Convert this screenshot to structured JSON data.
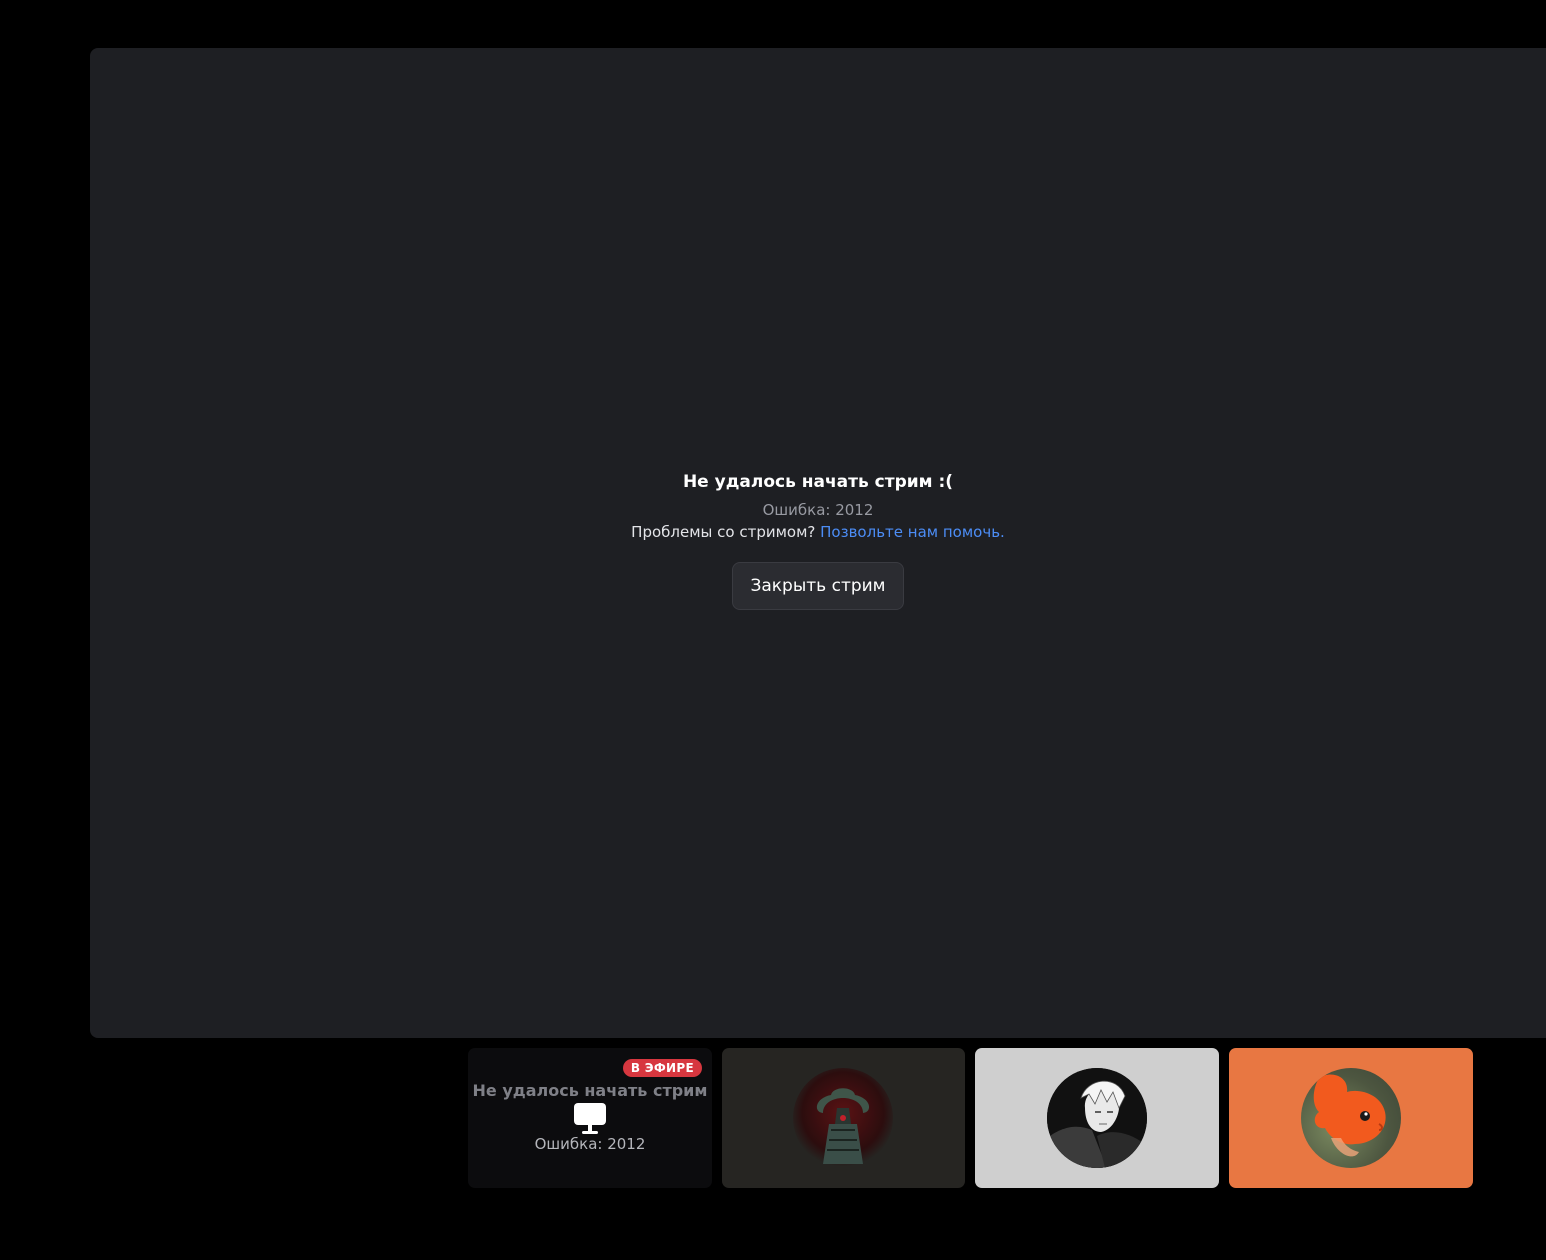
{
  "stream": {
    "error_title": "Не удалось начать стрим :(",
    "error_code": "Ошибка: 2012",
    "help_question": "Проблемы со стримом?",
    "help_link": "Позвольте нам помочь.",
    "close_button": "Закрыть стрим"
  },
  "tiles": {
    "stream_tile": {
      "live_badge": "В ЭФИРЕ",
      "title": "Не удалось начать стрим",
      "icon": "monitor-icon",
      "error_code": "Ошибка: 2012"
    },
    "participants": [
      {
        "avatar": "tree-figure-avatar",
        "background": "#262522"
      },
      {
        "avatar": "manga-character-avatar",
        "background": "#cfcfcf"
      },
      {
        "avatar": "orange-fish-avatar",
        "background": "#e87742"
      }
    ]
  },
  "colors": {
    "page_background": "#000000",
    "stage_background": "#1e1f23",
    "link": "#4c8df6",
    "live_badge": "#d7373f"
  }
}
